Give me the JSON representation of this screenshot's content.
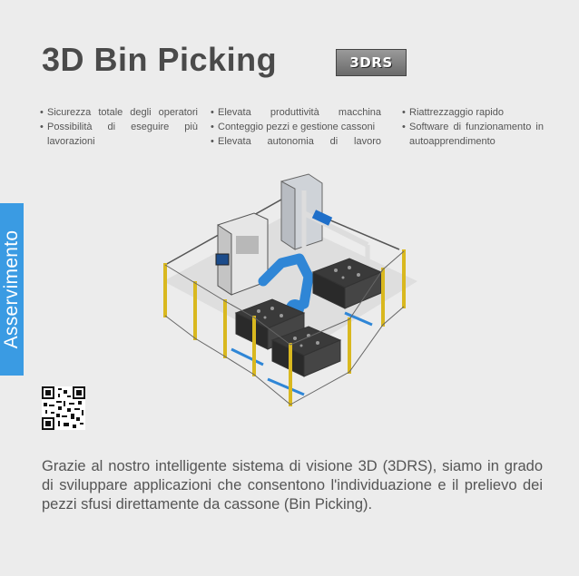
{
  "title": "3D Bin Picking",
  "logo_text": "3DRS",
  "features": {
    "col1": [
      "Sicurezza totale degli operatori",
      "Possibilità di eseguire più lavorazioni"
    ],
    "col2": [
      "Elevata produttività macchina",
      "Conteggio pezzi e gestione cassoni",
      "Elevata autonomia di lavoro"
    ],
    "col3": [
      "Riattrezzaggio rapido",
      "Software di funzionamento in autoapprendimento"
    ]
  },
  "side_tab": "Asservimento",
  "description": "Grazie al nostro intelligente sistema di visione 3D (3DRS), siamo in grado di sviluppare applicazioni che consentono l'individuazione e il prelievo dei pezzi sfusi direttamente da cassone (Bin Picking).",
  "colors": {
    "accent": "#3a9be3",
    "fence": "#d9b81f",
    "robot": "#2f86d6"
  },
  "icons": {
    "qr": "qr-code-icon",
    "illustration": "robot-cell-illustration"
  }
}
